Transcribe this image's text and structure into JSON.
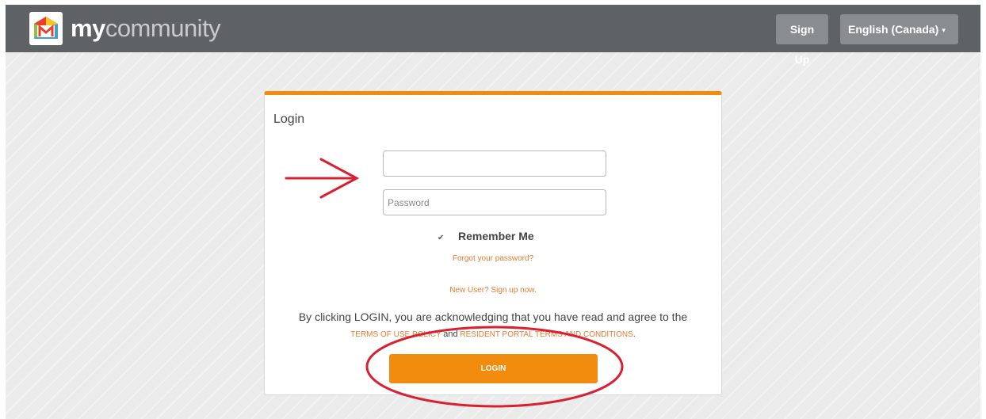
{
  "header": {
    "brand_bold": "my",
    "brand_light": "community",
    "signup_label": "Sign Up",
    "language_label": "English (Canada)"
  },
  "login": {
    "title": "Login",
    "username_placeholder": "",
    "password_placeholder": "Password",
    "remember_label": "Remember Me",
    "remember_checked": true,
    "forgot_link": "Forgot your password?",
    "new_user_link": "New User? Sign up now.",
    "terms_text": "By clicking LOGIN, you are acknowledging that you have read and agree to the",
    "terms_link_1": "TERMS OF USE POLICY",
    "terms_and": "and",
    "terms_link_2": "RESIDENT PORTAL TERMS AND CONDITIONS",
    "terms_end": ".",
    "login_button": "LOGIN"
  },
  "annotations": {
    "arrow_icon": "arrow-right-icon",
    "highlight_icon": "ellipse-highlight"
  },
  "colors": {
    "header_bg": "#5f6264",
    "accent": "#f28c0f",
    "link": "#e57c32",
    "annotation": "#d92031"
  }
}
